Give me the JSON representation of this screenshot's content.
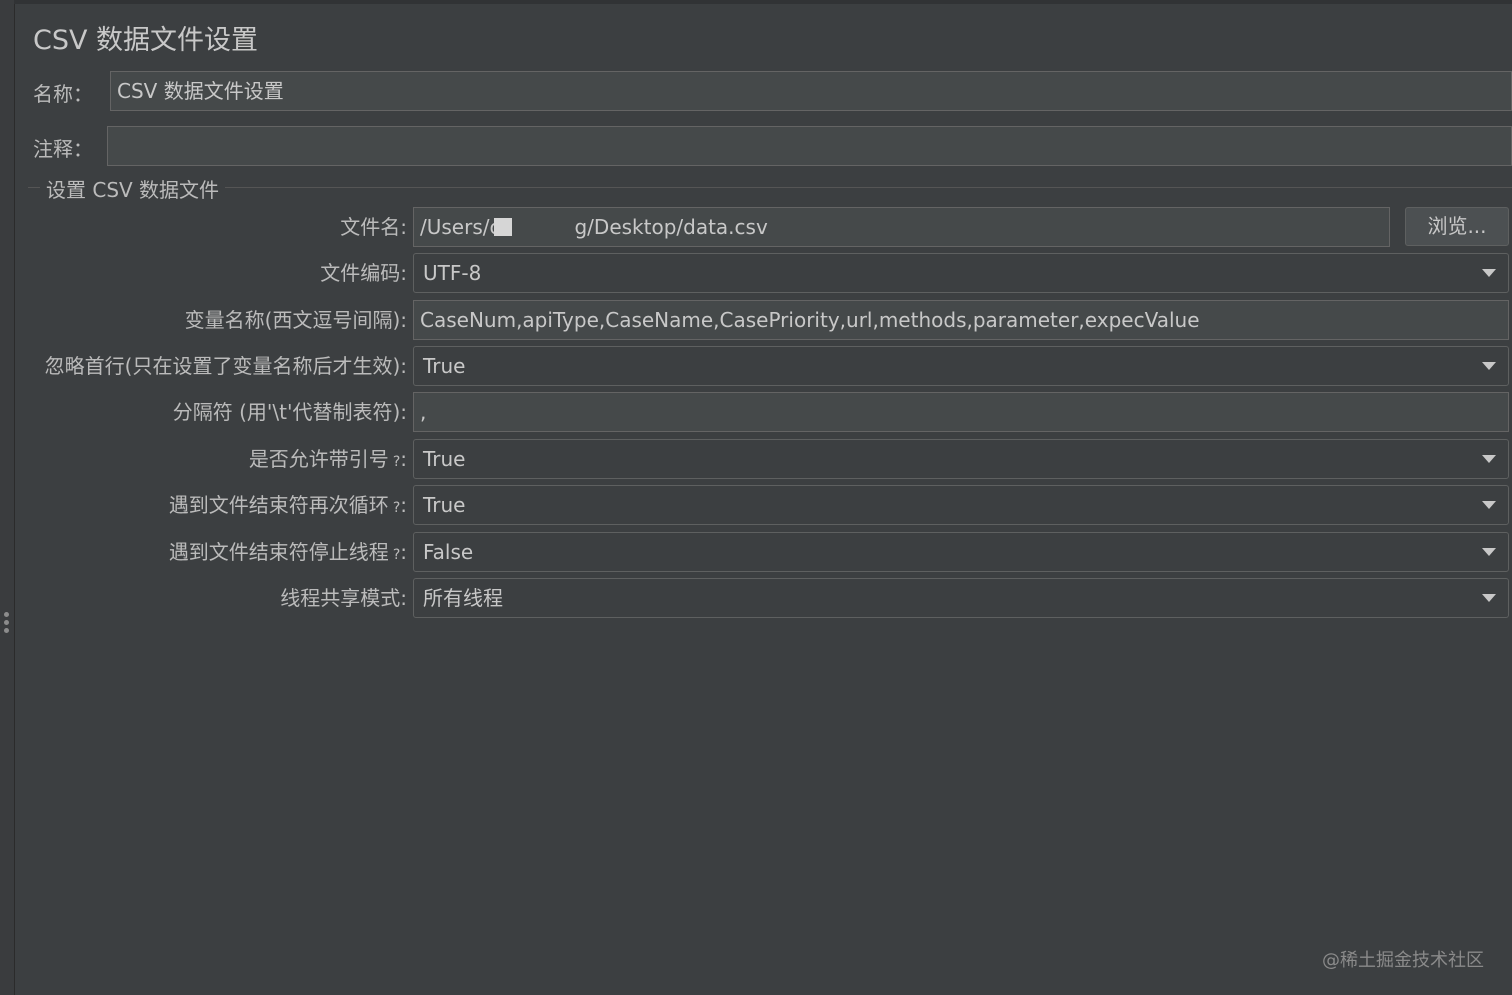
{
  "panel": {
    "title": "CSV 数据文件设置",
    "name_label": "名称：",
    "name_value": "CSV 数据文件设置",
    "comment_label": "注释：",
    "comment_value": ""
  },
  "group": {
    "title": "设置 CSV 数据文件",
    "filename": {
      "label": "文件名:",
      "value_prefix": "/Users/c",
      "value_suffix": "g/Desktop/data.csv",
      "browse_label": "浏览..."
    },
    "encoding": {
      "label": "文件编码:",
      "value": "UTF-8"
    },
    "variable_names": {
      "label": "变量名称(西文逗号间隔):",
      "value": "CaseNum,apiType,CaseName,CasePriority,url,methods,parameter,expecValue"
    },
    "ignore_first_line": {
      "label": "忽略首行(只在设置了变量名称后才生效):",
      "value": "True"
    },
    "delimiter": {
      "label": "分隔符 (用'\\t'代替制表符):",
      "value": ","
    },
    "allow_quoted": {
      "label": "是否允许带引号",
      "q": "?",
      "colon": ":",
      "value": "True"
    },
    "recycle_eof": {
      "label": "遇到文件结束符再次循环",
      "q": "?",
      "colon": ":",
      "value": "True"
    },
    "stop_thread_eof": {
      "label": "遇到文件结束符停止线程",
      "q": "?",
      "colon": ":",
      "value": "False"
    },
    "sharing_mode": {
      "label": "线程共享模式:",
      "value": "所有线程"
    }
  },
  "watermark": "@稀土掘金技术社区"
}
